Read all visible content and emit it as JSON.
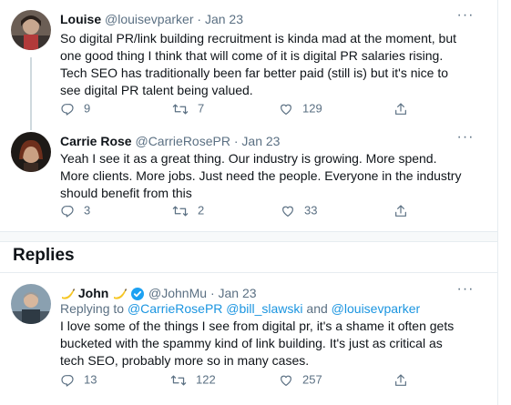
{
  "tweets": [
    {
      "name": "Louise",
      "handle": "@louisevparker",
      "dot": "·",
      "date": "Jan 23",
      "text": "So digital PR/link building recruitment is kinda mad at the moment, but one good thing I think that will come of it is digital PR salaries rising. Tech SEO has traditionally been far better paid (still is) but it's nice to see digital PR talent being valued.",
      "replies": "9",
      "retweets": "7",
      "likes": "129"
    },
    {
      "name": "Carrie Rose",
      "handle": "@CarrieRosePR",
      "dot": "·",
      "date": "Jan 23",
      "text": "Yeah I see it as a great thing. Our industry is growing. More spend. More clients. More jobs. Just need the people. Everyone in the industry should benefit from this",
      "replies": "3",
      "retweets": "2",
      "likes": "33"
    }
  ],
  "replies_section": {
    "title": "Replies",
    "tweet": {
      "name": "John",
      "handle": "@JohnMu",
      "dot": "·",
      "date": "Jan 23",
      "replying_prefix": "Replying to",
      "mentions": [
        "@CarrieRosePR",
        "@bill_slawski",
        "@louisevparker"
      ],
      "and": "and",
      "text": "I love some of the things I see from digital pr, it's a shame it often gets bucketed with the spammy kind of link building. It's just as critical as tech SEO, probably more so in many cases.",
      "replies": "13",
      "retweets": "122",
      "likes": "257"
    }
  },
  "more_label": "···",
  "colors": {
    "accent": "#1b95e0",
    "muted": "#5b7083",
    "verified": "#1da1f2"
  },
  "icons": [
    "reply-icon",
    "retweet-icon",
    "like-icon",
    "share-icon",
    "more-icon",
    "verified-icon",
    "banana-emoji"
  ]
}
